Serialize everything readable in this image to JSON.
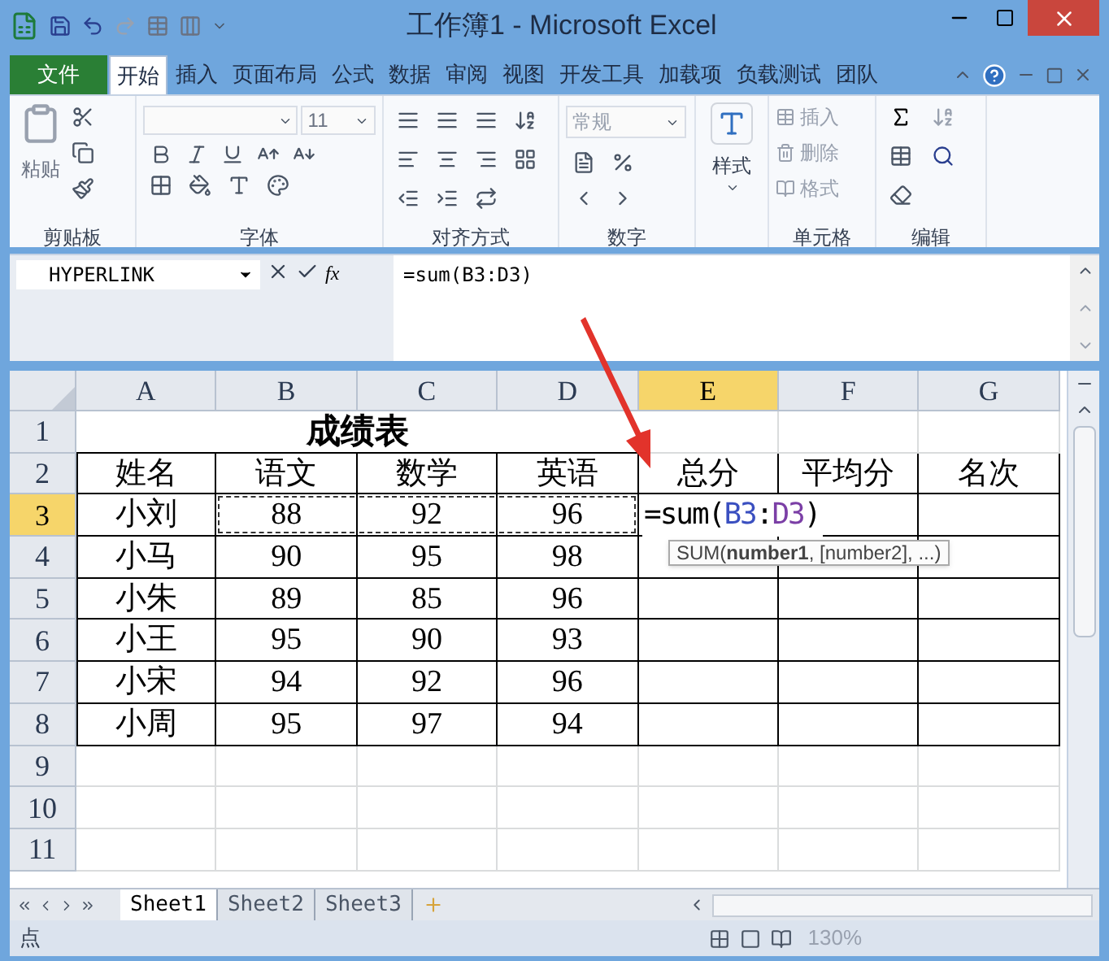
{
  "window": {
    "title": "工作簿1 - Microsoft Excel"
  },
  "ribbon_tabs": [
    {
      "label": "文件",
      "kind": "file",
      "selected": false
    },
    {
      "label": "开始",
      "kind": "tab",
      "selected": true
    },
    {
      "label": "插入",
      "kind": "tab",
      "selected": false
    },
    {
      "label": "页面布局",
      "kind": "tab",
      "selected": false
    },
    {
      "label": "公式",
      "kind": "tab",
      "selected": false
    },
    {
      "label": "数据",
      "kind": "tab",
      "selected": false
    },
    {
      "label": "审阅",
      "kind": "tab",
      "selected": false
    },
    {
      "label": "视图",
      "kind": "tab",
      "selected": false
    },
    {
      "label": "开发工具",
      "kind": "tab",
      "selected": false
    },
    {
      "label": "加载项",
      "kind": "tab",
      "selected": false
    },
    {
      "label": "负载测试",
      "kind": "tab",
      "selected": false
    },
    {
      "label": "团队",
      "kind": "tab",
      "selected": false
    }
  ],
  "ribbon_groups": [
    {
      "kind": "clipboard",
      "label": "剪贴板",
      "paste_label": "粘贴"
    },
    {
      "kind": "font",
      "label": "字体",
      "font_size": "11"
    },
    {
      "kind": "alignment",
      "label": "对齐方式"
    },
    {
      "kind": "number",
      "label": "数字",
      "number_format": "常规"
    },
    {
      "kind": "styles",
      "button_label": "样式"
    },
    {
      "kind": "cells",
      "label": "单元格",
      "commands": [
        "插入",
        "删除",
        "格式"
      ]
    },
    {
      "kind": "editing",
      "label": "编辑"
    }
  ],
  "formula_bar": {
    "name_box": "HYPERLINK",
    "function_button": "fx",
    "formula": "=sum(B3:D3)"
  },
  "sheet": {
    "columns": [
      {
        "label": "A",
        "selected": false
      },
      {
        "label": "B",
        "selected": false
      },
      {
        "label": "C",
        "selected": false
      },
      {
        "label": "D",
        "selected": false
      },
      {
        "label": "E",
        "selected": true
      },
      {
        "label": "F",
        "selected": false
      },
      {
        "label": "G",
        "selected": false
      }
    ],
    "rows": [
      {
        "number": "1",
        "selected": false,
        "title": "成绩表"
      },
      {
        "number": "2",
        "selected": false,
        "cells": [
          "姓名",
          "语文",
          "数学",
          "英语",
          "总分",
          "平均分",
          "名次"
        ]
      },
      {
        "number": "3",
        "selected": true,
        "cells": [
          {
            "text": "小刘",
            "referenced": false
          },
          {
            "text": "88",
            "referenced": true
          },
          {
            "text": "92",
            "referenced": true
          },
          {
            "text": "96",
            "referenced": true
          }
        ]
      },
      {
        "number": "4",
        "selected": false,
        "cells": [
          "小马",
          "90",
          "95",
          "98"
        ]
      },
      {
        "number": "5",
        "selected": false,
        "cells": [
          "小朱",
          "89",
          "85",
          "96"
        ]
      },
      {
        "number": "6",
        "selected": false,
        "cells": [
          "小王",
          "95",
          "90",
          "93"
        ]
      },
      {
        "number": "7",
        "selected": false,
        "cells": [
          "小宋",
          "94",
          "92",
          "96"
        ]
      },
      {
        "number": "8",
        "selected": false,
        "cells": [
          "小周",
          "95",
          "97",
          "94"
        ]
      },
      {
        "number": "9",
        "selected": false
      },
      {
        "number": "10",
        "selected": false
      },
      {
        "number": "11",
        "selected": false
      }
    ],
    "edit_parts": [
      {
        "text": "=sum("
      },
      {
        "text": "B3",
        "color": "#3a4fc0"
      },
      {
        "text": ":"
      },
      {
        "text": "D3",
        "color": "#7b3fa6"
      },
      {
        "text": ")"
      }
    ],
    "tooltip": "SUM(**number1**, [number2], ...)"
  },
  "sheet_tabs": [
    {
      "label": "Sheet1",
      "selected": true
    },
    {
      "label": "Sheet2",
      "selected": false
    },
    {
      "label": "Sheet3",
      "selected": false
    }
  ],
  "status_bar": {
    "mode": "点",
    "zoom": "130%"
  }
}
